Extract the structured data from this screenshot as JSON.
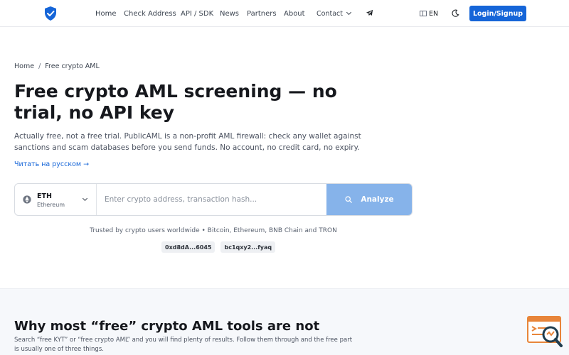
{
  "header": {
    "nav": {
      "home": "Home",
      "check_address": "Check Address",
      "api_sdk": "API / SDK",
      "news": "News",
      "partners": "Partners",
      "about": "About",
      "contact": "Contact"
    },
    "language": "EN",
    "login_label": "Login/Signup"
  },
  "breadcrumb": {
    "home": "Home",
    "separator": "/",
    "current": "Free crypto AML"
  },
  "hero": {
    "title": "Free crypto AML screening — no trial, no API key",
    "lead": "Actually free, not a free trial. PublicAML is a non-profit AML firewall: check any wallet against sanctions and scam databases before you send funds. No account, no credit card, no expiry.",
    "ru_link": "Читать на русском →"
  },
  "search": {
    "chain_code": "ETH",
    "chain_name": "Ethereum",
    "placeholder": "Enter crypto address, transaction hash...",
    "analyze_label": "Analyze"
  },
  "trusted_text": "Trusted by crypto users worldwide • Bitcoin, Ethereum, BNB Chain and TRON",
  "example_chips": [
    "0xd8dA...6045",
    "bc1qxy2...fyaq"
  ],
  "why": {
    "title": "Why most “free” crypto AML tools are not",
    "text": "Search “free KYT” or “free crypto AML” and you will find plenty of results. Follow them through and the free part is usually one of three things."
  },
  "colors": {
    "primary": "#1565d8",
    "analyze_button": "#86b3ea",
    "widget_accent": "#e8853a",
    "widget_dark": "#1f3d4f"
  },
  "icons": [
    "shield-check-icon",
    "telegram-icon",
    "moon-icon",
    "ethereum-icon",
    "search-icon",
    "chevron-down-icon",
    "support-widget-icon"
  ]
}
